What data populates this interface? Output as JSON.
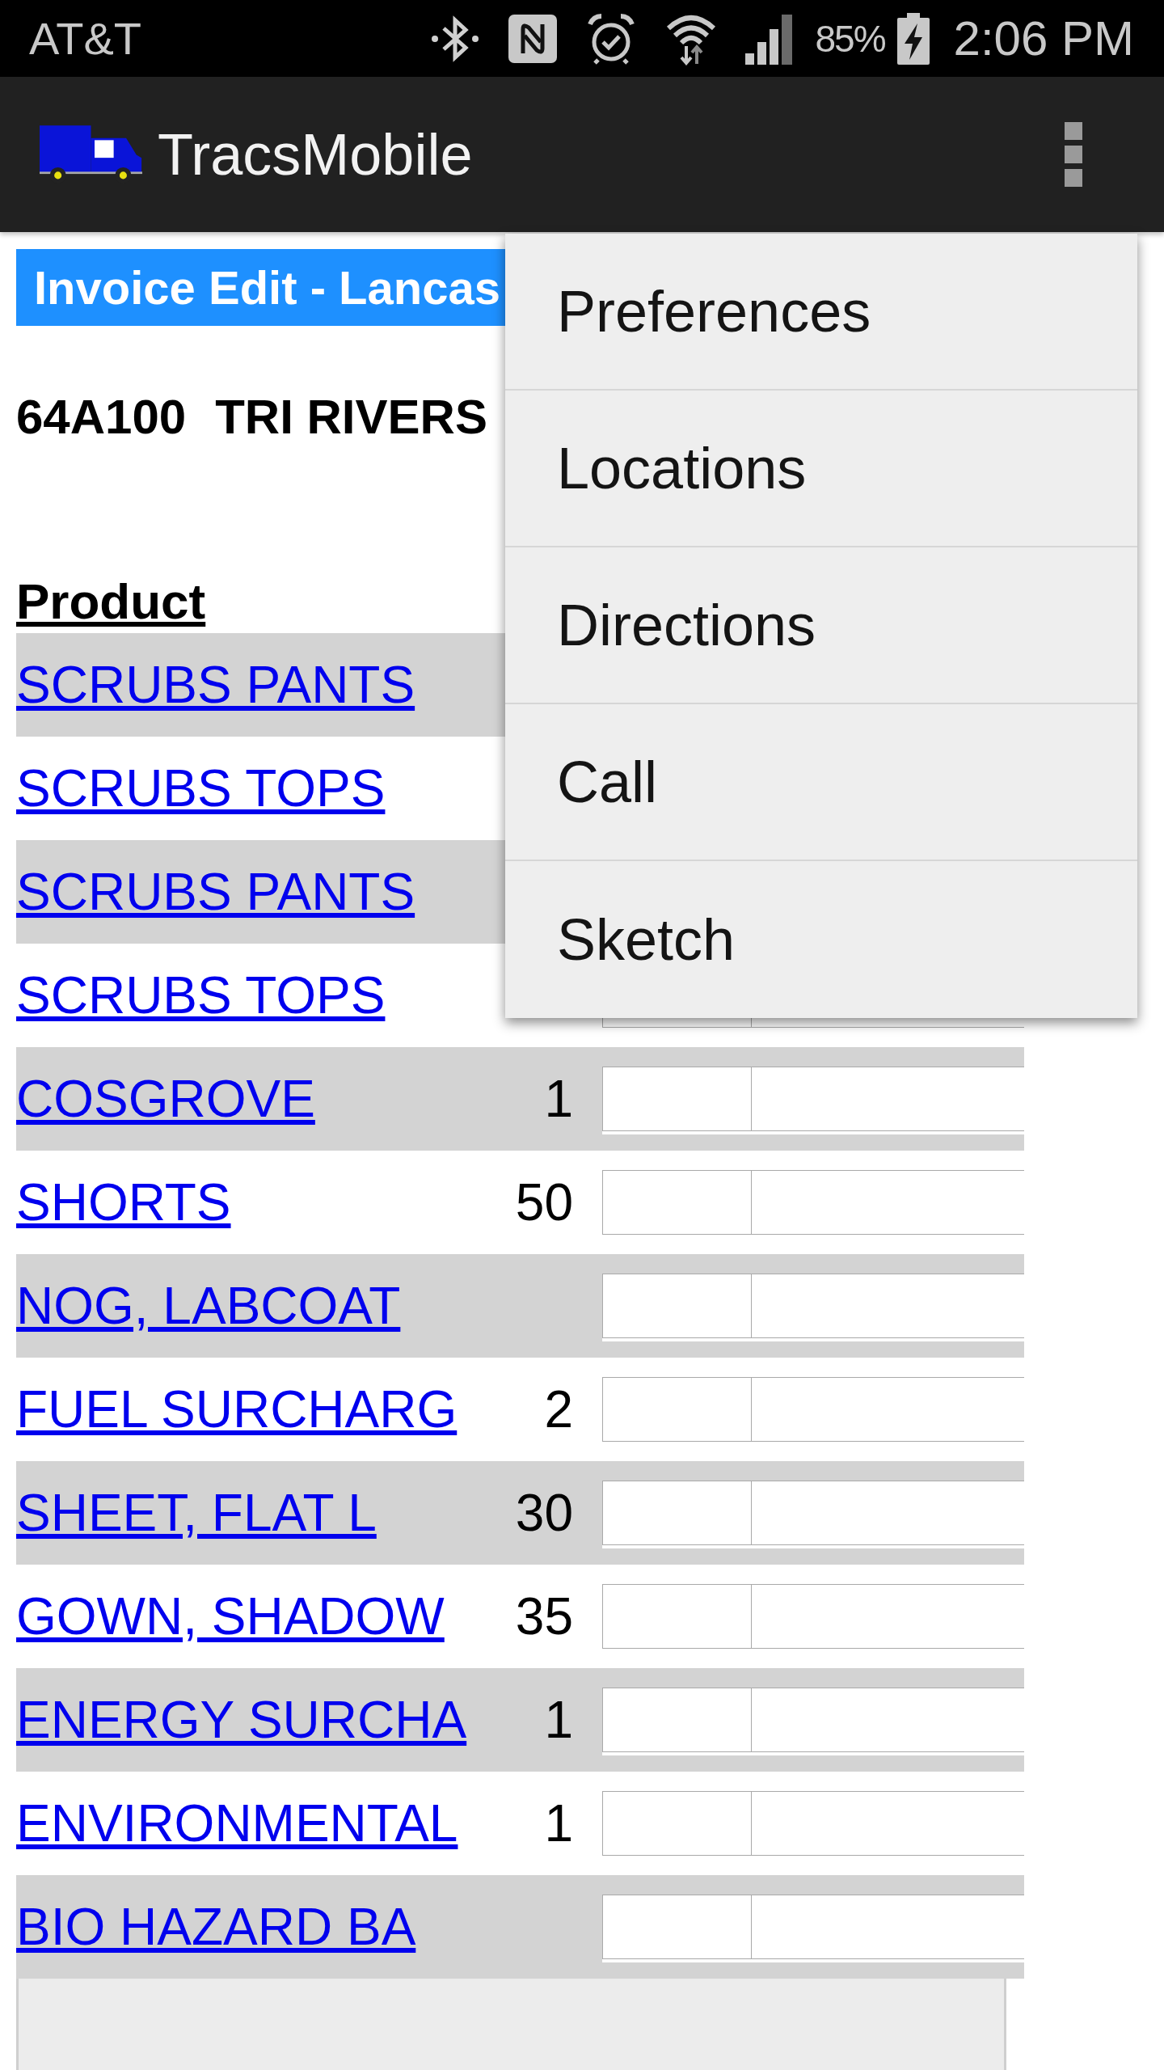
{
  "status_bar": {
    "carrier": "AT&T",
    "battery": "85%",
    "time": "2:06 PM"
  },
  "app_bar": {
    "title": "TracsMobile"
  },
  "overflow_menu": {
    "items": [
      "Preferences",
      "Locations",
      "Directions",
      "Call",
      "Sketch"
    ]
  },
  "page_title": "Invoice Edit - Lancas",
  "customer": {
    "account": "64A100",
    "name": "TRI RIVERS"
  },
  "table": {
    "columns": [
      "Product"
    ],
    "rows": [
      {
        "product": "SCRUBS PANTS"
      },
      {
        "product": "SCRUBS TOPS"
      },
      {
        "product": "SCRUBS PANTS"
      },
      {
        "product": "SCRUBS TOPS"
      },
      {
        "product": "COSGROVE",
        "qty": "1"
      },
      {
        "product": "SHORTS",
        "qty": "50"
      },
      {
        "product": "NOG, LABCOAT"
      },
      {
        "product": "FUEL SURCHARG",
        "qty": "2"
      },
      {
        "product": "SHEET, FLAT L",
        "qty": "30"
      },
      {
        "product": "GOWN, SHADOW",
        "qty": "35"
      },
      {
        "product": "ENERGY SURCHA",
        "qty": "1"
      },
      {
        "product": "ENVIRONMENTAL",
        "qty": "1"
      },
      {
        "product": "BIO HAZARD BA"
      }
    ]
  }
}
